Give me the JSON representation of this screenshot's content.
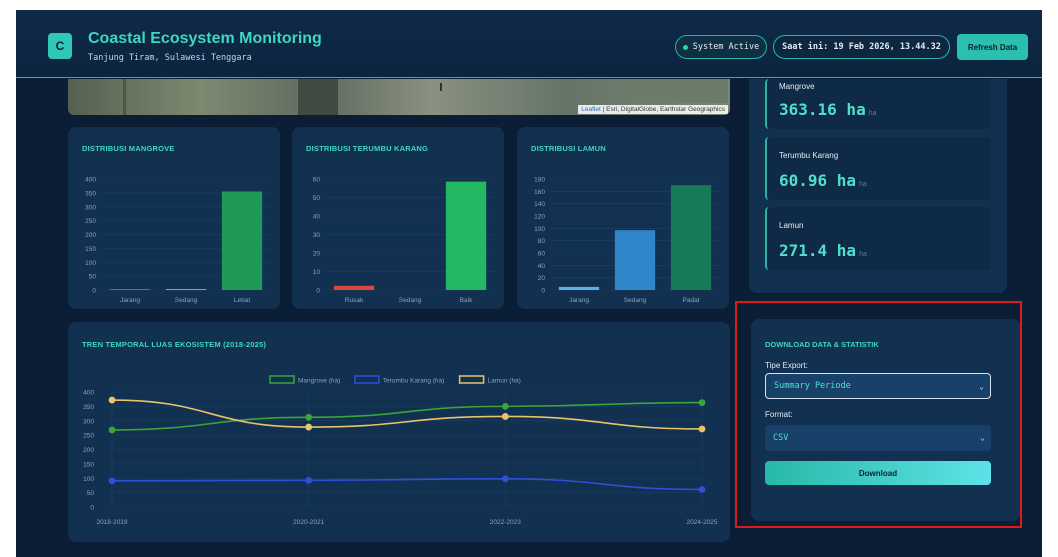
{
  "header": {
    "logo_letter": "C",
    "title": "Coastal Ecosystem Monitoring",
    "subtitle": "Tanjung Tiram, Sulawesi Tenggara",
    "status": "System Active",
    "time": "Saat ini: 19 Feb 2026, 13.44.32",
    "refresh_label": "Refresh Data"
  },
  "map": {
    "attribution_link": "Leaflet",
    "attribution_text": " | Esri, DigitalGlobe, Earthstar Geographics"
  },
  "stats": [
    {
      "label": "Mangrove",
      "value": "363.16 ha",
      "unit": "ha"
    },
    {
      "label": "Terumbu Karang",
      "value": "60.96 ha",
      "unit": "ha"
    },
    {
      "label": "Lamun",
      "value": "271.4 ha",
      "unit": "ha"
    }
  ],
  "download": {
    "title": "DOWNLOAD DATA & STATISTIK",
    "type_label": "Tipe Export:",
    "type_value": "Summary Periode",
    "format_label": "Format:",
    "format_value": "CSV",
    "button_label": "Download"
  },
  "chart_data": [
    {
      "type": "bar",
      "title": "DISTRIBUSI MANGROVE",
      "categories": [
        "Jarang",
        "Sedang",
        "Lebat"
      ],
      "values": [
        1,
        3,
        355
      ],
      "colors": [
        "#2f8a5a",
        "#e0901e",
        "#1f9a56"
      ],
      "ylim": [
        0,
        400
      ],
      "yticks": [
        0,
        50,
        100,
        150,
        200,
        250,
        300,
        350,
        400
      ]
    },
    {
      "type": "bar",
      "title": "DISTRIBUSI TERUMBU KARANG",
      "categories": [
        "Rusak",
        "Sedang",
        "Baik"
      ],
      "values": [
        2.3,
        0,
        58.6
      ],
      "colors": [
        "#d9483b",
        "#e0a020",
        "#22b861"
      ],
      "ylim": [
        0,
        60
      ],
      "yticks": [
        0,
        10,
        20,
        30,
        40,
        50,
        60
      ]
    },
    {
      "type": "bar",
      "title": "DISTRIBUSI LAMUN",
      "categories": [
        "Jarang",
        "Sedang",
        "Padat"
      ],
      "values": [
        5,
        97,
        170
      ],
      "colors": [
        "#5bb0e6",
        "#2f86c9",
        "#157a55"
      ],
      "ylim": [
        0,
        180
      ],
      "yticks": [
        0,
        20,
        40,
        60,
        80,
        100,
        120,
        140,
        160,
        180
      ]
    },
    {
      "type": "line",
      "title": "TREN TEMPORAL LUAS EKOSISTEM (2018-2025)",
      "categories": [
        "2018-2019",
        "2020-2021",
        "2022-2023",
        "2024-2025"
      ],
      "ylim": [
        0,
        400
      ],
      "yticks": [
        0,
        50,
        100,
        150,
        200,
        250,
        300,
        350,
        400
      ],
      "legend_position": "top",
      "series": [
        {
          "name": "Mangrove (ha)",
          "color": "#3aa53a",
          "values": [
            268,
            312,
            350,
            363.16
          ]
        },
        {
          "name": "Terumbu Karang (ha)",
          "color": "#2f4fd8",
          "values": [
            91,
            93,
            98,
            60.96
          ]
        },
        {
          "name": "Lamun (ha)",
          "color": "#e8c46a",
          "values": [
            372,
            278,
            315,
            271.4
          ]
        }
      ]
    }
  ]
}
